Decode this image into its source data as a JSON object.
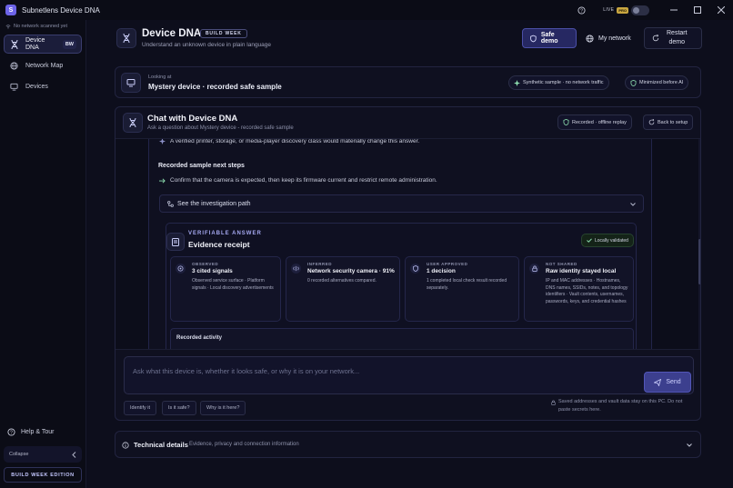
{
  "app": {
    "title": "Subnetlens Device DNA",
    "logo_letter": "S",
    "live_label": "LIVE",
    "pro_label": "PRO"
  },
  "sidebar": {
    "network_status": "No network scanned yet",
    "items": [
      {
        "label": "Device DNA",
        "badge": "BW",
        "icon": "dna-icon"
      },
      {
        "label": "Network Map",
        "icon": "globe-icon"
      },
      {
        "label": "Devices",
        "icon": "monitor-icon"
      }
    ],
    "help_label": "Help & Tour",
    "collapse_label": "Collapse",
    "edition_label": "BUILD WEEK EDITION"
  },
  "header": {
    "title": "Device DNA",
    "badge": "BUILD WEEK",
    "subtitle": "Understand an unknown device in plain language",
    "safe_demo_label": "Safe demo",
    "my_network_label": "My network",
    "restart_demo_label_1": "Restart",
    "restart_demo_label_2": "demo"
  },
  "looking_at": {
    "label": "Looking at",
    "value": "Mystery device · recorded safe sample",
    "pill_synthetic": "Synthetic sample · no network traffic",
    "pill_minimized": "Minimized before AI"
  },
  "chat": {
    "title": "Chat with Device DNA",
    "subtitle": "Ask a question about Mystery device - recorded safe sample",
    "replay_label": "Recorded · offline replay",
    "back_label": "Back to setup",
    "line_prev": "A verified printer, storage, or media-player discovery class would materially change this answer.",
    "next_steps_heading": "Recorded sample next steps",
    "next_step": "Confirm that the camera is expected, then keep its firmware current and restrict remote administration.",
    "investigation_label": "See the investigation path",
    "receipt": {
      "kicker": "VERIFIABLE ANSWER",
      "title": "Evidence receipt",
      "validated": "Locally validated",
      "stats": [
        {
          "label": "OBSERVED",
          "value": "3 cited signals",
          "desc": "Observed service surface · Platform signals · Local discovery advertisements"
        },
        {
          "label": "INFERRED",
          "value": "Network security camera · 91%",
          "desc": "0 recorded alternatives compared."
        },
        {
          "label": "USER APPROVED",
          "value": "1 decision",
          "desc": "1 completed local check result recorded separately."
        },
        {
          "label": "NOT SHARED",
          "value": "Raw identity stayed local",
          "desc": "IP and MAC addresses · Hostnames, DNS names, SSIDs, notes, and topology identifiers · Vault contents, usernames, passwords, keys, and credential hashes"
        }
      ],
      "activity_label": "Recorded activity"
    },
    "input_placeholder": "Ask what this device is, whether it looks safe, or why it is on your network...",
    "send_label": "Send",
    "suggestions": [
      "Identify it",
      "Is it safe?",
      "Why is it here?"
    ],
    "privacy_note_1": "Saved addresses and vault data stay on this PC. Do not",
    "privacy_note_2": "paste secrets here."
  },
  "technical": {
    "title": "Technical details",
    "subtitle": "Evidence, privacy and connection information"
  },
  "colors": {
    "accent": "#6d64e8",
    "background": "#0d0e1c",
    "success": "#5fd38a",
    "pro": "#c9a640"
  }
}
